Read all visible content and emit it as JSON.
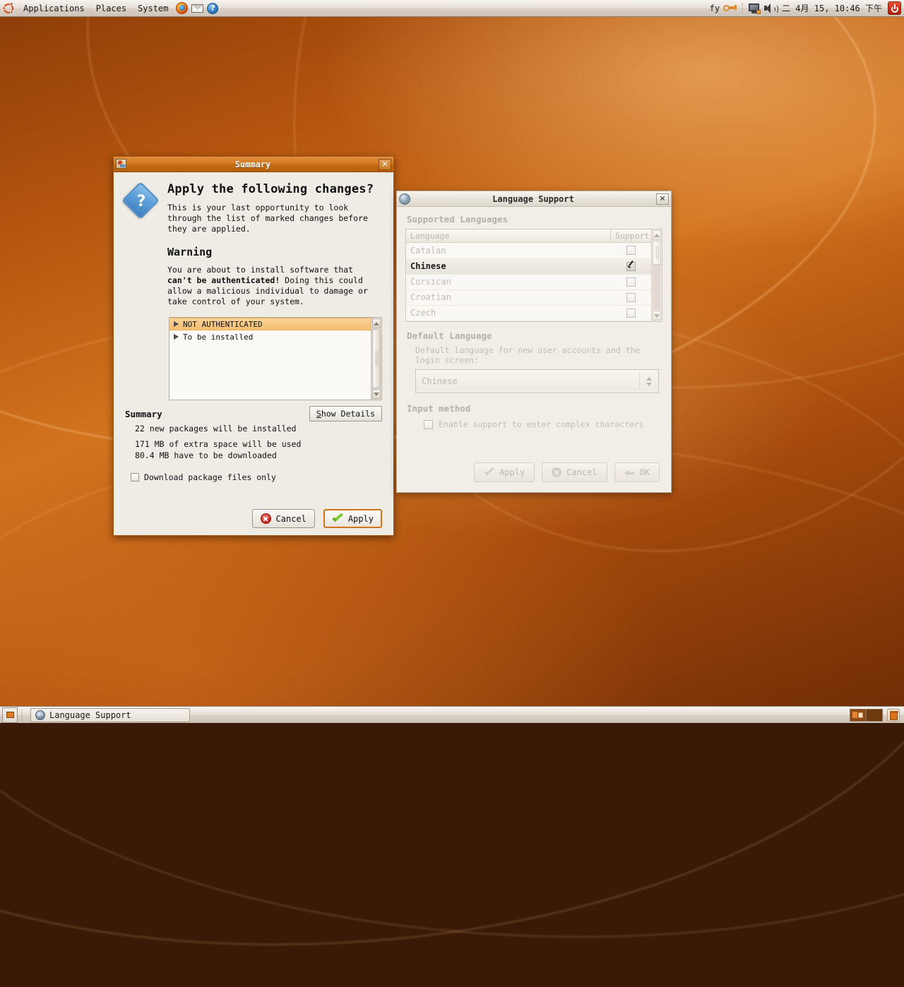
{
  "top_panel": {
    "logo_icon": "ubuntu-logo-icon",
    "menus": [
      "Applications",
      "Places",
      "System"
    ],
    "launchers": [
      "firefox-icon",
      "mail-icon",
      "help-icon"
    ],
    "keyboard_indicator": "fy",
    "tray_icons": [
      "restricted-drivers-icon",
      "network-monitor-icon",
      "volume-icon"
    ],
    "clock": "二 4月 15, 10:46 下午",
    "power_icon": "power-icon"
  },
  "bottom_panel": {
    "show_desktop_icon": "show-desktop-icon",
    "tasks": [
      {
        "label": "Language Support",
        "icon": "globe-icon"
      }
    ],
    "workspaces": [
      {
        "name": "workspace-1",
        "active": true
      },
      {
        "name": "workspace-2",
        "active": false
      }
    ],
    "trash_icon": "trash-icon"
  },
  "summary_dialog": {
    "title": "Summary",
    "window_icon": "synaptic-icon",
    "close_label": "✕",
    "question_icon": "question-mark-icon",
    "heading": "Apply the following changes?",
    "intro": "This is your last opportunity to look through the list of marked changes before they are applied.",
    "warning_heading": "Warning",
    "warning_part1": "You are about to install software that ",
    "warning_bold": "can't be authenticated!",
    "warning_part2": " Doing this could allow a malicious individual to damage or take control of your system.",
    "changes": [
      {
        "label": "NOT AUTHENTICATED",
        "selected": true
      },
      {
        "label": "To be installed",
        "selected": false
      }
    ],
    "summary_title": "Summary",
    "stats": [
      "22 new packages will be installed",
      "171 MB of extra space will be used",
      "80.4 MB have to be downloaded"
    ],
    "show_details_label": "Show Details",
    "download_only_label": "Download package files only",
    "download_only_checked": false,
    "cancel_label": "Cancel",
    "apply_label": "Apply",
    "accent_color": "#d2741a"
  },
  "language_window": {
    "title": "Language Support",
    "window_icon": "globe-icon",
    "close_label": "✕",
    "supported_section": "Supported Languages",
    "columns": [
      "Language",
      "Support"
    ],
    "languages": [
      {
        "name": "Catalan",
        "supported": false,
        "selected": false
      },
      {
        "name": "Chinese",
        "supported": true,
        "selected": true
      },
      {
        "name": "Corsican",
        "supported": false,
        "selected": false
      },
      {
        "name": "Croatian",
        "supported": false,
        "selected": false
      },
      {
        "name": "Czech",
        "supported": false,
        "selected": false
      }
    ],
    "default_section": "Default Language",
    "default_description": "Default language for new user accounts and the login screen:",
    "default_value": "Chinese",
    "input_method_section": "Input method",
    "input_method_label": "Enable support to enter complex characters",
    "input_method_checked": false,
    "apply_label": "Apply",
    "cancel_label": "Cancel",
    "ok_label": "OK"
  }
}
